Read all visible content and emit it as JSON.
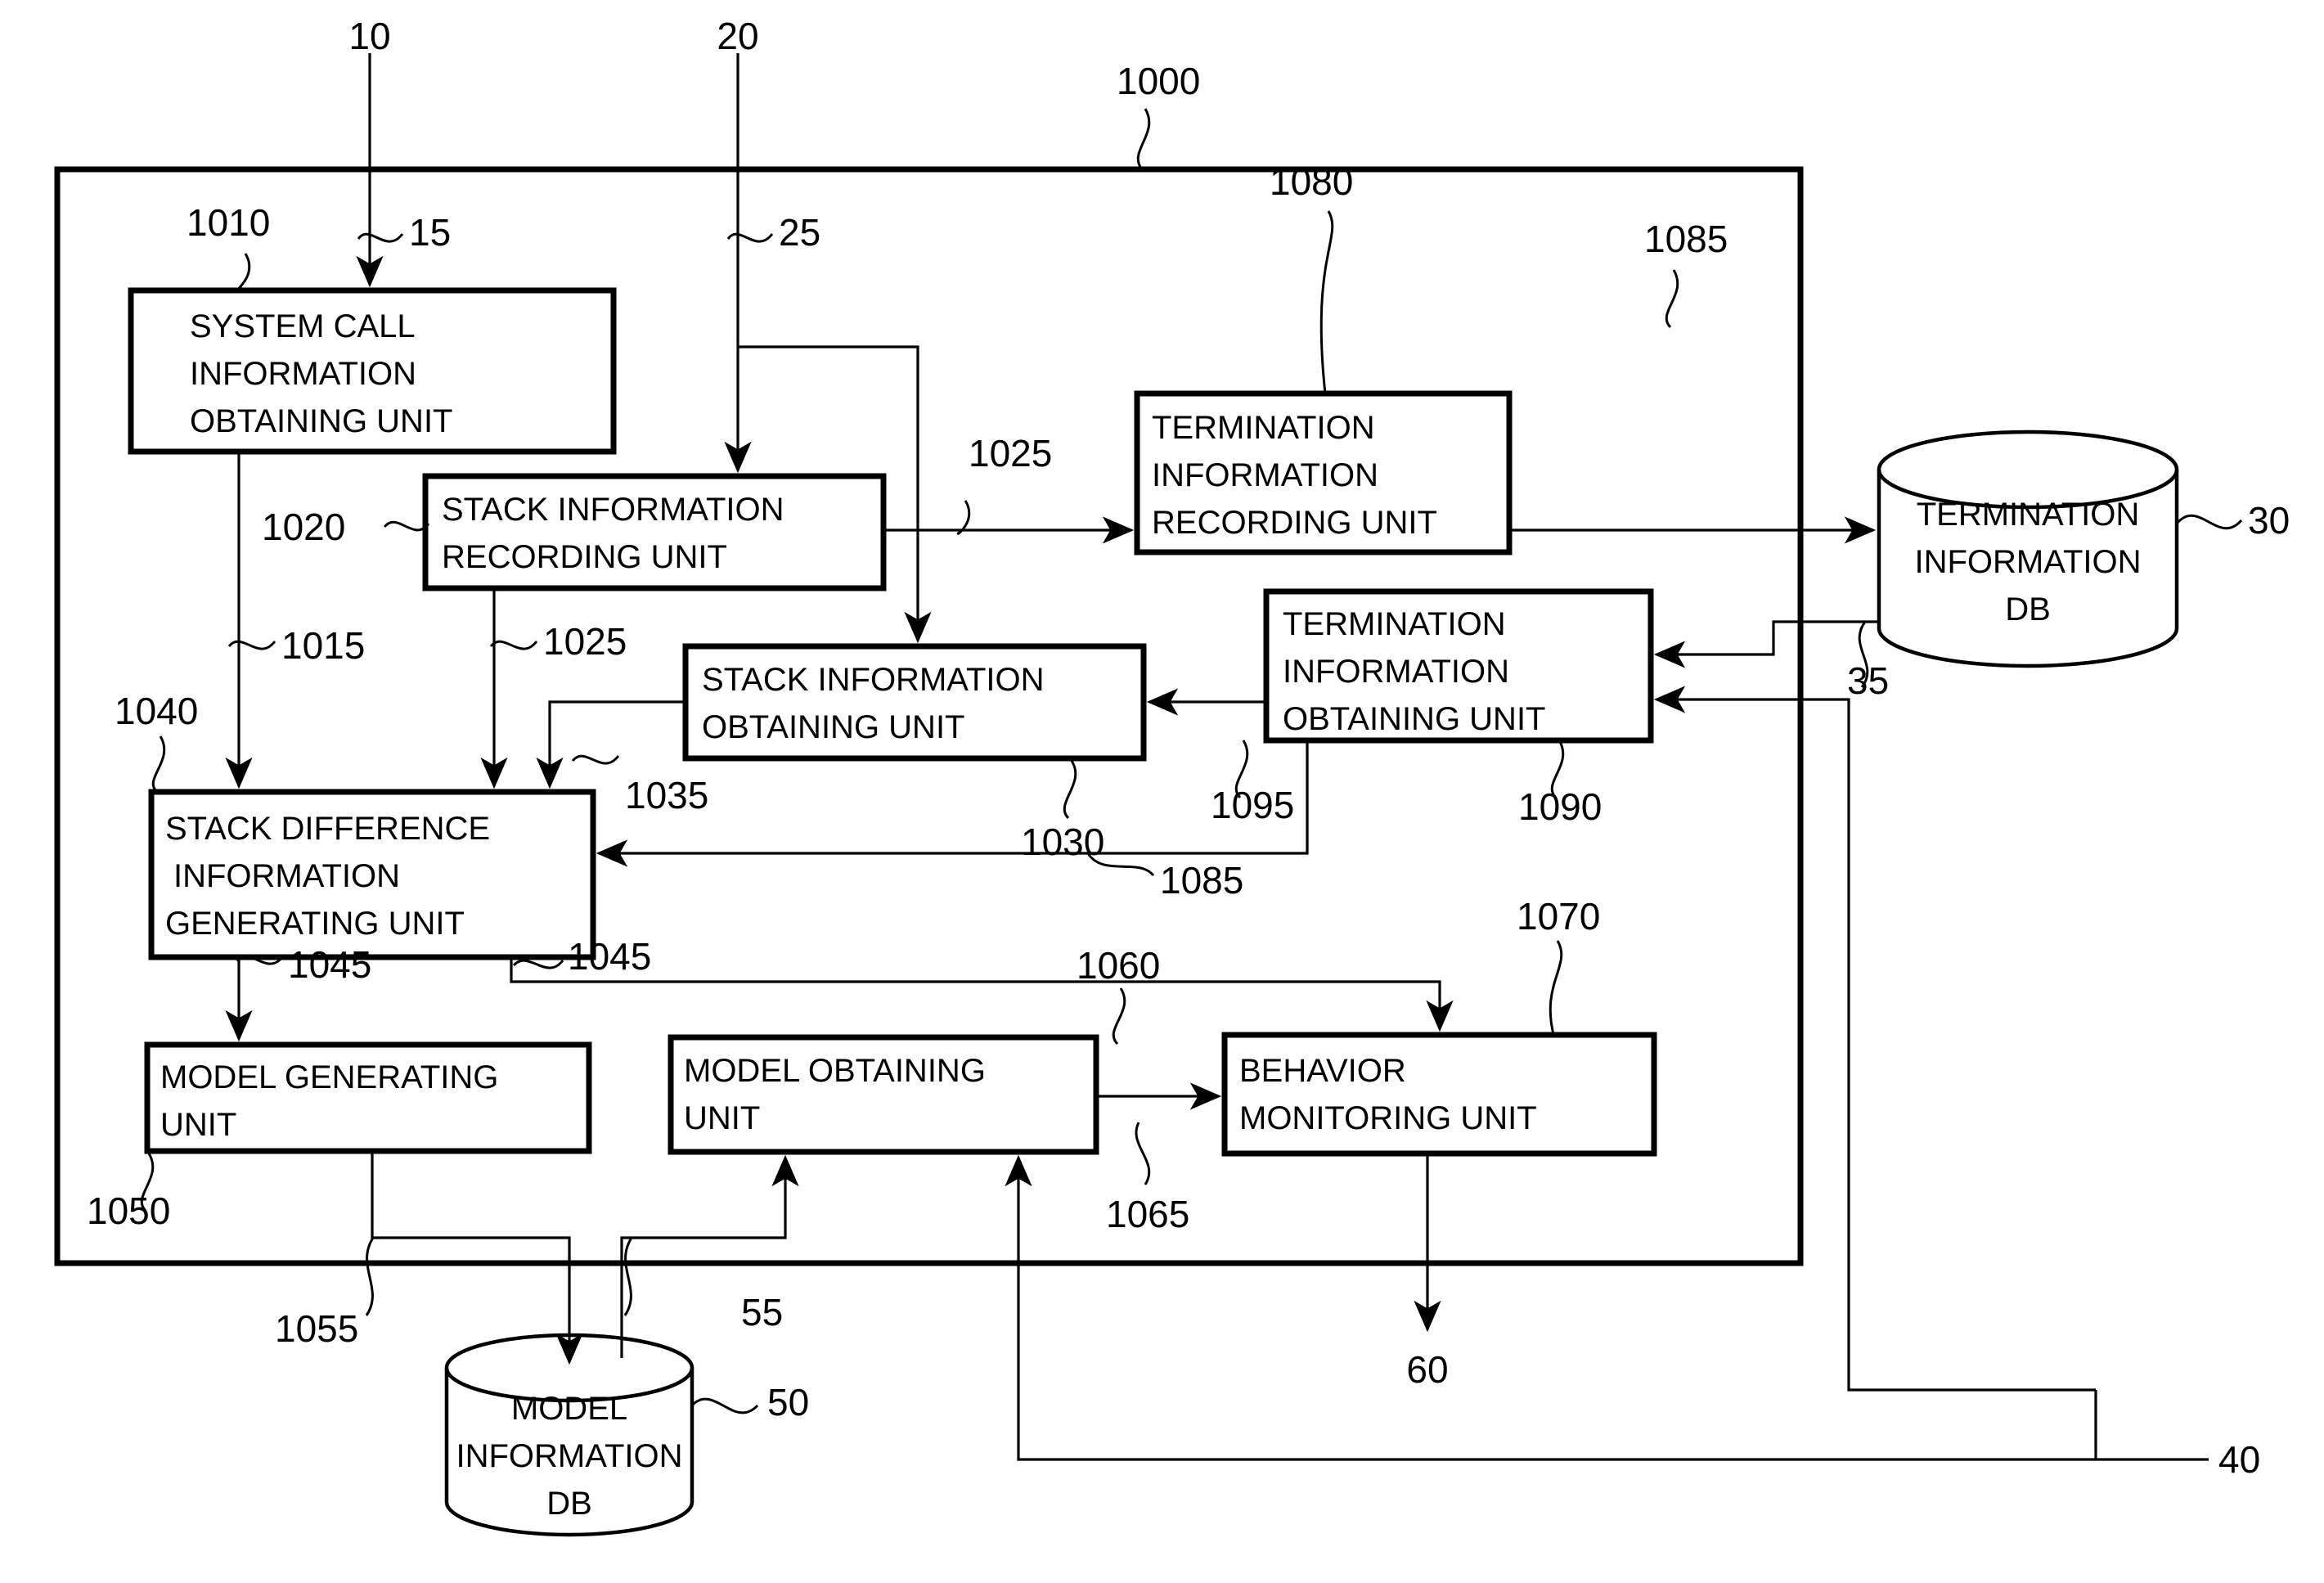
{
  "figure": {
    "type": "patent-block-diagram",
    "outer_system_ref": "1000"
  },
  "boxes": [
    {
      "id": "system-call-information-obtaining-unit",
      "lines": [
        "SYSTEM CALL",
        "INFORMATION",
        "OBTAINING UNIT"
      ],
      "ref": "1010"
    },
    {
      "id": "stack-information-recording-unit",
      "lines": [
        "STACK INFORMATION",
        "RECORDING UNIT"
      ],
      "ref": "1020"
    },
    {
      "id": "stack-information-obtaining-unit",
      "lines": [
        "STACK INFORMATION",
        "OBTAINING UNIT"
      ],
      "ref": "1030"
    },
    {
      "id": "termination-information-recording-unit",
      "lines": [
        "TERMINATION",
        "INFORMATION",
        "RECORDING UNIT"
      ],
      "ref": "1080"
    },
    {
      "id": "termination-information-obtaining-unit",
      "lines": [
        "TERMINATION",
        "INFORMATION",
        "OBTAINING UNIT"
      ],
      "ref": "1090"
    },
    {
      "id": "stack-difference-information-generating-unit",
      "lines": [
        "STACK DIFFERENCE",
        "INFORMATION",
        "GENERATING UNIT"
      ],
      "ref": "1040"
    },
    {
      "id": "model-generating-unit",
      "lines": [
        "MODEL GENERATING",
        "UNIT"
      ],
      "ref": "1050"
    },
    {
      "id": "model-obtaining-unit",
      "lines": [
        "MODEL OBTAINING",
        "UNIT"
      ],
      "ref": "1060"
    },
    {
      "id": "behavior-monitoring-unit",
      "lines": [
        "BEHAVIOR",
        "MONITORING UNIT"
      ],
      "ref": "1070"
    }
  ],
  "databases": [
    {
      "id": "termination-information-db",
      "lines": [
        "TERMINATION",
        "INFORMATION",
        "DB"
      ],
      "ref": "30"
    },
    {
      "id": "model-information-db",
      "lines": [
        "MODEL",
        "INFORMATION",
        "DB"
      ],
      "ref": "50"
    }
  ],
  "labels": {
    "n10": "10",
    "n20": "20",
    "n1000": "1000",
    "n1010": "1010",
    "n15": "15",
    "n25": "25",
    "n1025_top": "1025",
    "n1080": "1080",
    "n1085_top": "1085",
    "n30": "30",
    "n1020": "1020",
    "n1015": "1015",
    "n1025_mid": "1025",
    "n35": "35",
    "n1040": "1040",
    "n1035": "1035",
    "n1030": "1030",
    "n1095": "1095",
    "n1090": "1090",
    "n1085_mid": "1085",
    "n1045_left": "1045",
    "n1045_right": "1045",
    "n1070": "1070",
    "n1060": "1060",
    "n1065": "1065",
    "n1050": "1050",
    "n1055": "1055",
    "n55": "55",
    "n50": "50",
    "n60": "60",
    "n40": "40"
  },
  "box_text": {
    "system_call": {
      "l1": "SYSTEM CALL",
      "l2": "INFORMATION",
      "l3": "OBTAINING UNIT"
    },
    "stack_rec": {
      "l1": "STACK INFORMATION",
      "l2": "RECORDING UNIT"
    },
    "stack_obt": {
      "l1": "STACK INFORMATION",
      "l2": "OBTAINING UNIT"
    },
    "term_rec": {
      "l1": "TERMINATION",
      "l2": "INFORMATION",
      "l3": "RECORDING UNIT"
    },
    "term_obt": {
      "l1": "TERMINATION",
      "l2": "INFORMATION",
      "l3": "OBTAINING UNIT"
    },
    "stack_diff": {
      "l1": "STACK DIFFERENCE",
      "l2": "INFORMATION",
      "l3": "GENERATING UNIT"
    },
    "model_gen": {
      "l1": "MODEL GENERATING",
      "l2": "UNIT"
    },
    "model_obt": {
      "l1": "MODEL OBTAINING",
      "l2": "UNIT"
    },
    "behavior": {
      "l1": "BEHAVIOR",
      "l2": "MONITORING UNIT"
    },
    "term_db": {
      "l1": "TERMINATION",
      "l2": "INFORMATION",
      "l3": "DB"
    },
    "model_db": {
      "l1": "MODEL",
      "l2": "INFORMATION",
      "l3": "DB"
    }
  },
  "colors": {
    "ink": "#000000",
    "paper": "#ffffff"
  }
}
